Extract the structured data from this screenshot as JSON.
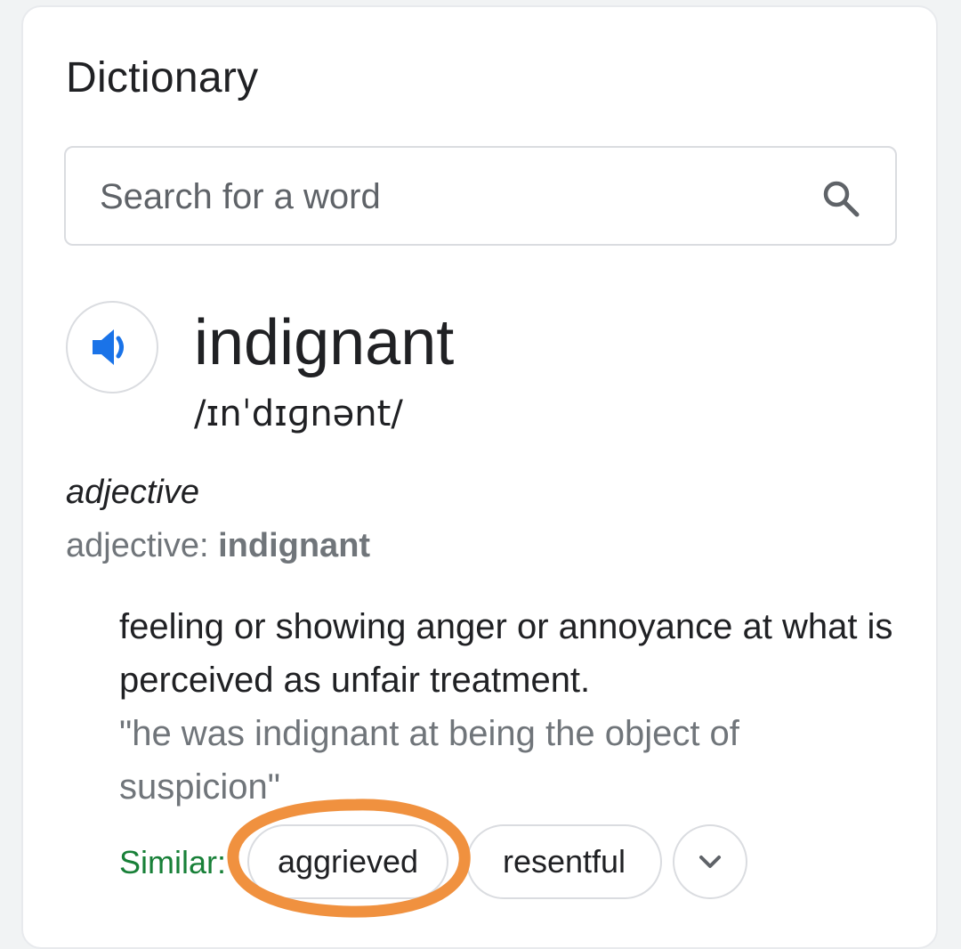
{
  "card": {
    "title": "Dictionary"
  },
  "search": {
    "placeholder": "Search for a word",
    "value": ""
  },
  "entry": {
    "word": "indignant",
    "phonetic": "/ɪnˈdɪɡnənt/",
    "part_of_speech": "adjective",
    "pos_label_prefix": "adjective: ",
    "pos_label_word": "indignant",
    "definition": "feeling or showing anger or annoyance at what is perceived as unfair treatment.",
    "example": "\"he was indignant at being the object of suspicion\"",
    "similar_label": "Similar:",
    "similar": [
      "aggrieved",
      "resentful"
    ]
  },
  "colors": {
    "accent_blue": "#1a73e8",
    "similar_green": "#188038",
    "annotation_orange": "#f0913f",
    "muted_gray": "#70757a"
  },
  "icons": {
    "search": "search-icon",
    "speaker": "speaker-icon",
    "expand": "chevron-down-icon"
  }
}
